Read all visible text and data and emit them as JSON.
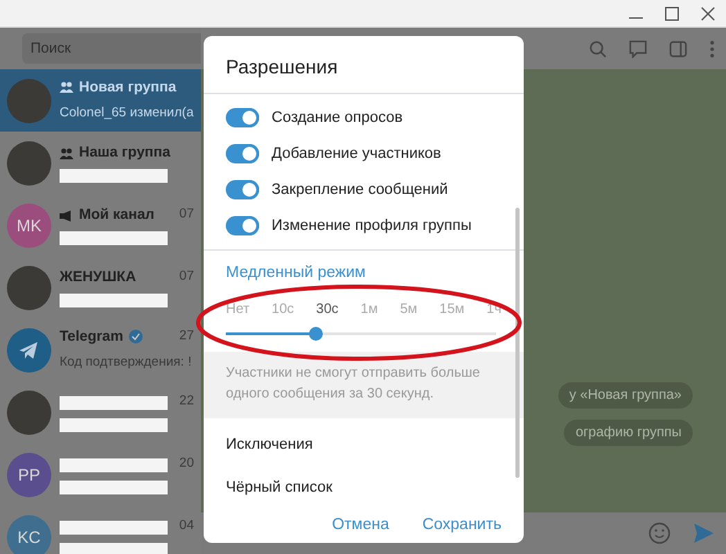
{
  "sidebar": {
    "search": {
      "placeholder": "Поиск"
    },
    "chats": [
      {
        "kind": "group",
        "name": "Новая группа",
        "preview": "Colonel_65 изменил(а",
        "selected": true,
        "redacted": false,
        "verified": false
      },
      {
        "kind": "group",
        "name": "Наша группа",
        "selected": false,
        "redacted": true,
        "verified": false
      },
      {
        "kind": "channel",
        "name": "Мой канал",
        "time": "07",
        "initials": "MK",
        "color": "#9b4e7e",
        "selected": false,
        "redacted": true,
        "verified": false
      },
      {
        "kind": "user",
        "name": "ЖЕНУШКА",
        "time": "07",
        "selected": false,
        "redacted": true,
        "verified": false
      },
      {
        "kind": "service",
        "name": "Telegram",
        "preview": "Код подтверждения: !",
        "time": "27",
        "selected": false,
        "redacted": false,
        "verified": true
      },
      {
        "kind": "user",
        "time": "22",
        "selected": false,
        "redacted": true,
        "verified": false
      },
      {
        "kind": "user",
        "time": "20",
        "initials": "PP",
        "color": "#5b4e8f",
        "selected": false,
        "redacted": true,
        "verified": false
      },
      {
        "kind": "user",
        "time": "04",
        "initials": "KC",
        "color": "#3f6e8f",
        "selected": false,
        "redacted": true,
        "verified": false
      }
    ]
  },
  "chat": {
    "service_messages": [
      "у «Новая группа»",
      "ографию группы"
    ]
  },
  "dialog": {
    "title": "Разрешения",
    "toggles": [
      {
        "label": "Создание опросов",
        "on": true
      },
      {
        "label": "Добавление участников",
        "on": true
      },
      {
        "label": "Закрепление сообщений",
        "on": true
      },
      {
        "label": "Изменение профиля группы",
        "on": true
      }
    ],
    "slow_mode": {
      "title": "Медленный режим",
      "options": [
        {
          "label": "Нет",
          "selected": false
        },
        {
          "label": "10с",
          "selected": false
        },
        {
          "label": "30с",
          "selected": true
        },
        {
          "label": "1м",
          "selected": false
        },
        {
          "label": "5м",
          "selected": false
        },
        {
          "label": "15м",
          "selected": false
        },
        {
          "label": "1ч",
          "selected": false
        }
      ],
      "level": 0.333,
      "description": "Участники не смогут отправить больше одного сообщения за 30 секунд."
    },
    "links": [
      "Исключения",
      "Чёрный список"
    ],
    "buttons": [
      "Отмена",
      "Сохранить"
    ]
  }
}
